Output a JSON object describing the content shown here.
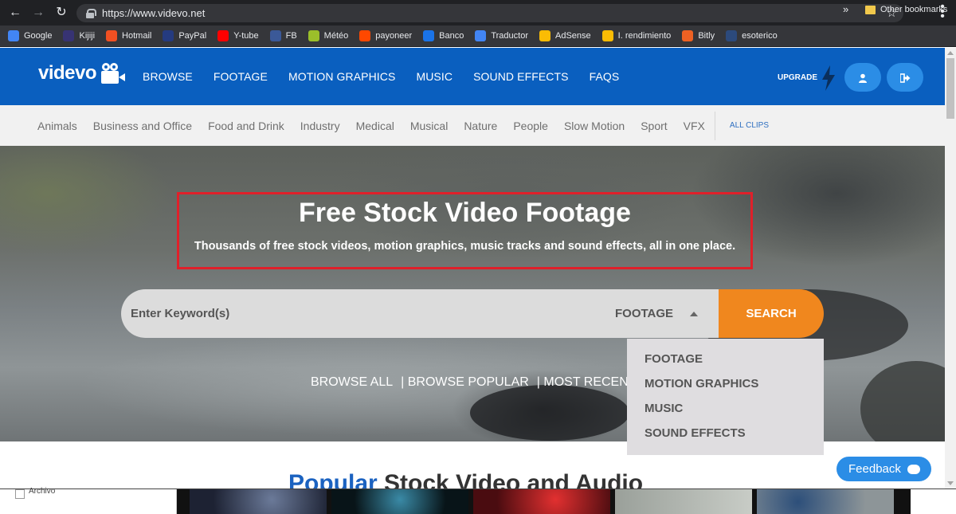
{
  "browser": {
    "url": "https://www.videvo.net",
    "bookmarks": [
      {
        "label": "Google",
        "icon": "google-icon",
        "color": "#4285f4"
      },
      {
        "label": "Kijiji",
        "icon": "kijiji-icon",
        "color": "#373373"
      },
      {
        "label": "Hotmail",
        "icon": "hotmail-icon",
        "color": "#f25022"
      },
      {
        "label": "PayPal",
        "icon": "paypal-icon",
        "color": "#253b80"
      },
      {
        "label": "Y-tube",
        "icon": "youtube-icon",
        "color": "#ff0000"
      },
      {
        "label": "FB",
        "icon": "facebook-icon",
        "color": "#3b5998"
      },
      {
        "label": "Météo",
        "icon": "meteo-icon",
        "color": "#9bbf2a"
      },
      {
        "label": "payoneer",
        "icon": "payoneer-icon",
        "color": "#ff4800"
      },
      {
        "label": "Banco",
        "icon": "banco-icon",
        "color": "#1a73e8"
      },
      {
        "label": "Traductor",
        "icon": "translate-icon",
        "color": "#4285f4"
      },
      {
        "label": "AdSense",
        "icon": "adsense-icon",
        "color": "#fbbc04"
      },
      {
        "label": "I. rendimiento",
        "icon": "rendimiento-icon",
        "color": "#fbbc04"
      },
      {
        "label": "Bitly",
        "icon": "bitly-icon",
        "color": "#ee6123"
      },
      {
        "label": "esoterico",
        "icon": "esoterico-icon",
        "color": "#2c4a7c"
      }
    ],
    "more": "»",
    "other_bookmarks": "Other bookmarks"
  },
  "site": {
    "logo": "videvo",
    "nav": [
      "BROWSE",
      "FOOTAGE",
      "MOTION GRAPHICS",
      "MUSIC",
      "SOUND EFFECTS",
      "FAQS"
    ],
    "upgrade": "UPGRADE",
    "brand_color": "#0a5fbf",
    "accent_color": "#f0871e"
  },
  "categories": {
    "items": [
      "Animals",
      "Business and Office",
      "Food and Drink",
      "Industry",
      "Medical",
      "Musical",
      "Nature",
      "People",
      "Slow Motion",
      "Sport",
      "VFX"
    ],
    "all_clips": "ALL CLIPS"
  },
  "hero": {
    "title": "Free Stock Video Footage",
    "subtitle": "Thousands of free stock videos, motion graphics, music tracks and sound effects, all in one place.",
    "search_placeholder": "Enter Keyword(s)",
    "selected_type": "FOOTAGE",
    "search_button": "SEARCH",
    "browse_links": [
      "BROWSE ALL",
      "|  BROWSE POPULAR",
      "|  MOST RECENT"
    ],
    "type_options": [
      "FOOTAGE",
      "MOTION GRAPHICS",
      "MUSIC",
      "SOUND EFFECTS"
    ]
  },
  "section": {
    "popular_strong": "Popular",
    "popular_rest": " Stock Video and Audio"
  },
  "feedback": "Feedback",
  "bottom": {
    "file_label": "Archivo"
  }
}
